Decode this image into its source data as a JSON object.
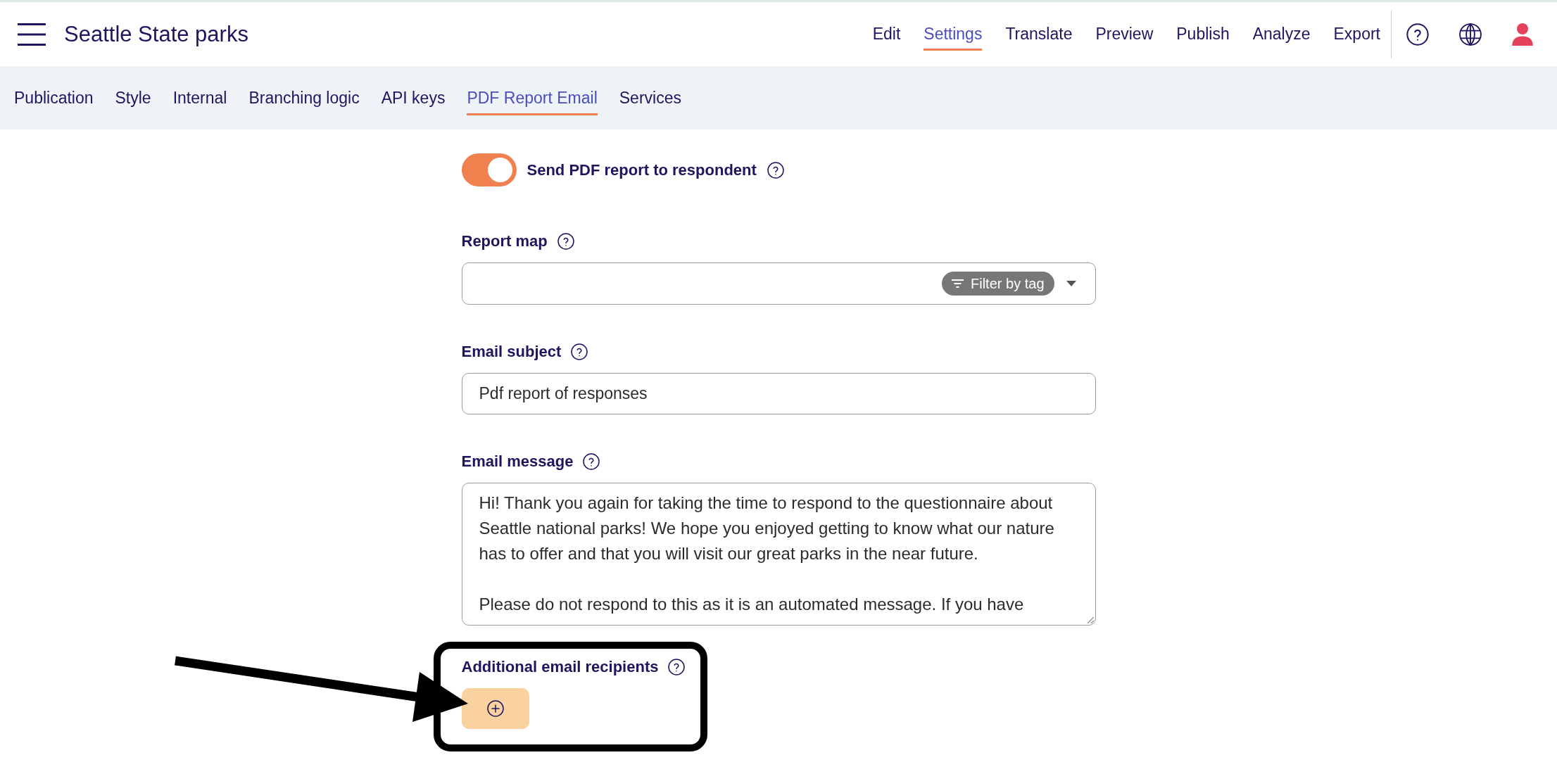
{
  "header": {
    "title": "Seattle State parks",
    "nav": [
      {
        "label": "Edit",
        "selected": false
      },
      {
        "label": "Settings",
        "selected": true
      },
      {
        "label": "Translate",
        "selected": false
      },
      {
        "label": "Preview",
        "selected": false
      },
      {
        "label": "Publish",
        "selected": false
      },
      {
        "label": "Analyze",
        "selected": false
      },
      {
        "label": "Export",
        "selected": false
      }
    ]
  },
  "settings_tabs": [
    {
      "label": "Publication",
      "selected": false
    },
    {
      "label": "Style",
      "selected": false
    },
    {
      "label": "Internal",
      "selected": false
    },
    {
      "label": "Branching logic",
      "selected": false
    },
    {
      "label": "API keys",
      "selected": false
    },
    {
      "label": "PDF Report Email",
      "selected": true
    },
    {
      "label": "Services",
      "selected": false
    }
  ],
  "fields": [
    {
      "kind": "toggle",
      "label": "Send PDF report to respondent",
      "on": true,
      "highlighted": false
    },
    {
      "kind": "select",
      "label": "Report map",
      "filter": "Filter by tag",
      "highlighted": false
    },
    {
      "kind": "text",
      "label": "Email subject",
      "value": "Pdf report of responses",
      "highlighted": false
    },
    {
      "kind": "textarea",
      "label": "Email message",
      "paragraphs": [
        "Hi! Thank you again for taking the time to respond to the questionnaire about Seattle national parks! We hope you enjoyed getting to know what our nature has to offer and that you will visit our great parks in the near future.",
        "Please do not respond to this as it is an automated message. If you have"
      ],
      "highlighted": false
    },
    {
      "kind": "add-list",
      "label": "Additional email recipients",
      "highlighted": true
    }
  ]
}
